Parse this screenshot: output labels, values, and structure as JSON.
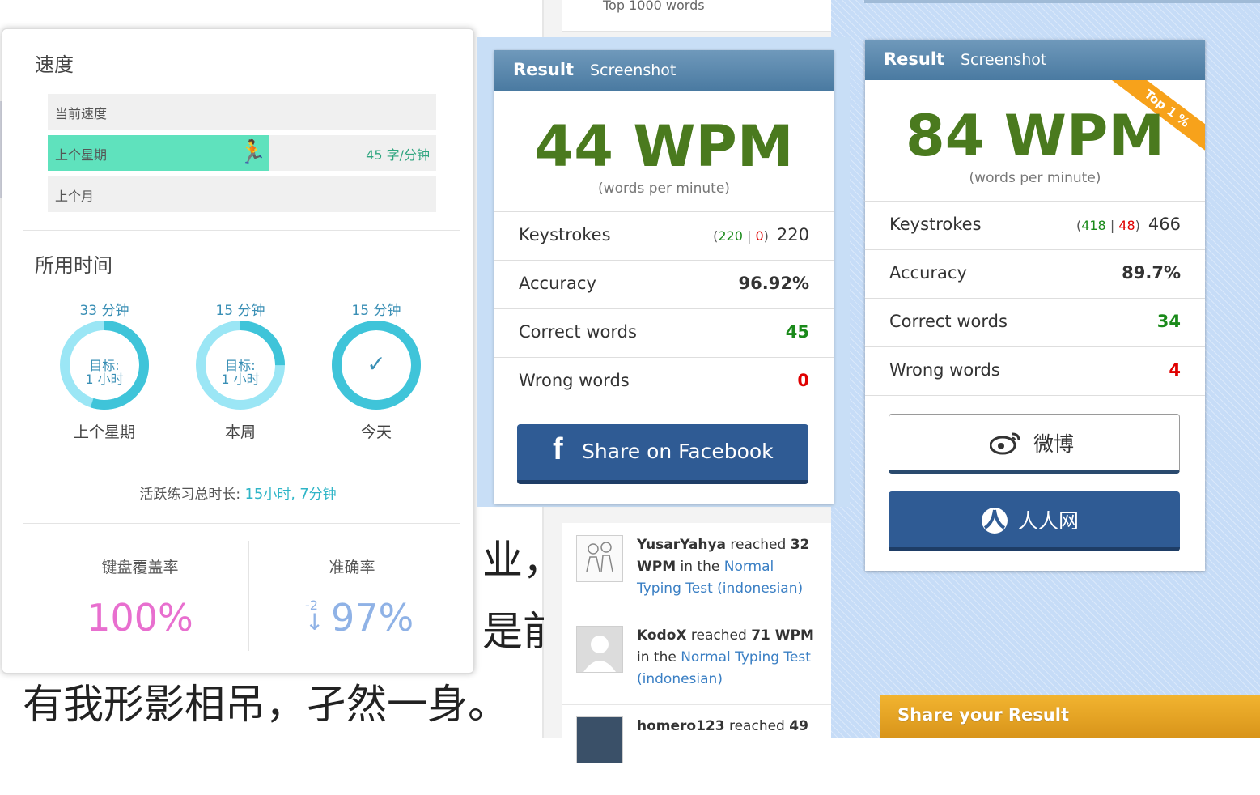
{
  "background": {
    "top_words": "Top 1000 words",
    "text_line1": "业，Z",
    "text_line2": "是前​",
    "text_line3": "有我形影相吊，孑然一身。"
  },
  "stats": {
    "speed_title": "速度",
    "speed_rows": [
      {
        "label": "当前速度",
        "value": "",
        "fill": 0
      },
      {
        "label": "上个星期",
        "value": "45 字/分钟",
        "fill": 0.57
      },
      {
        "label": "上个月",
        "value": "",
        "fill": 0
      }
    ],
    "time_title": "所用时间",
    "rings": [
      {
        "top": "33 分钟",
        "goal1": "目标:",
        "goal2": "1 小时",
        "bottom": "上个星期",
        "progress": 0.55
      },
      {
        "top": "15 分钟",
        "goal1": "目标:",
        "goal2": "1 小时",
        "bottom": "本周",
        "progress": 0.25
      },
      {
        "top": "15 分钟",
        "goal1": "",
        "goal2": "",
        "bottom": "今天",
        "progress": 1.0,
        "check": "✓"
      }
    ],
    "active_label": "活跃练习总时长: ",
    "active_hours_num": "15",
    "active_hours_unit": "小时, ",
    "active_min_num": "7",
    "active_min_unit": "分钟",
    "coverage_title": "键盘覆盖率",
    "coverage_value": "100%",
    "accuracy_title": "准确率",
    "accuracy_delta": "-2",
    "accuracy_value": "97%"
  },
  "result1": {
    "head_result": "Result",
    "head_screenshot": "Screenshot",
    "wpm": "44 WPM",
    "wpm_sub": "(words per minute)",
    "keystrokes_label": "Keystrokes",
    "ks_correct": "220",
    "ks_wrong": "0",
    "ks_total": "220",
    "accuracy_label": "Accuracy",
    "accuracy": "96.92%",
    "correct_label": "Correct words",
    "correct": "45",
    "wrong_label": "Wrong words",
    "wrong": "0",
    "share_fb": "Share on Facebook"
  },
  "result2": {
    "head_result": "Result",
    "head_screenshot": "Screenshot",
    "ribbon": "Top 1 %",
    "wpm": "84 WPM",
    "wpm_sub": "(words per minute)",
    "keystrokes_label": "Keystrokes",
    "ks_correct": "418",
    "ks_wrong": "48",
    "ks_total": "466",
    "accuracy_label": "Accuracy",
    "accuracy": "89.7%",
    "correct_label": "Correct words",
    "correct": "34",
    "wrong_label": "Wrong words",
    "wrong": "4",
    "weibo": "微博",
    "renren": "人人网"
  },
  "feed": [
    {
      "user": "YusarYahya",
      "mid": " reached ",
      "wpm": "32 WPM",
      "in": " in the ",
      "test": "Normal Typing Test (indonesian)"
    },
    {
      "user": "KodoX",
      "mid": " reached ",
      "wpm": "71 WPM",
      "in": " in the ",
      "test": "Normal Typing Test (indonesian)"
    },
    {
      "user": "homero123",
      "mid": " reached ",
      "wpm": "49",
      "in": "",
      "test": ""
    }
  ],
  "share_result": "Share your Result",
  "colors": {
    "wpm_green": "#4a7a1e",
    "link_blue": "#3a7fc4",
    "fb_blue": "#2f5b94",
    "ribbon_orange": "#f7a21b",
    "coverage_pink": "#e86fcf",
    "accuracy_blue": "#8fb2e6"
  }
}
